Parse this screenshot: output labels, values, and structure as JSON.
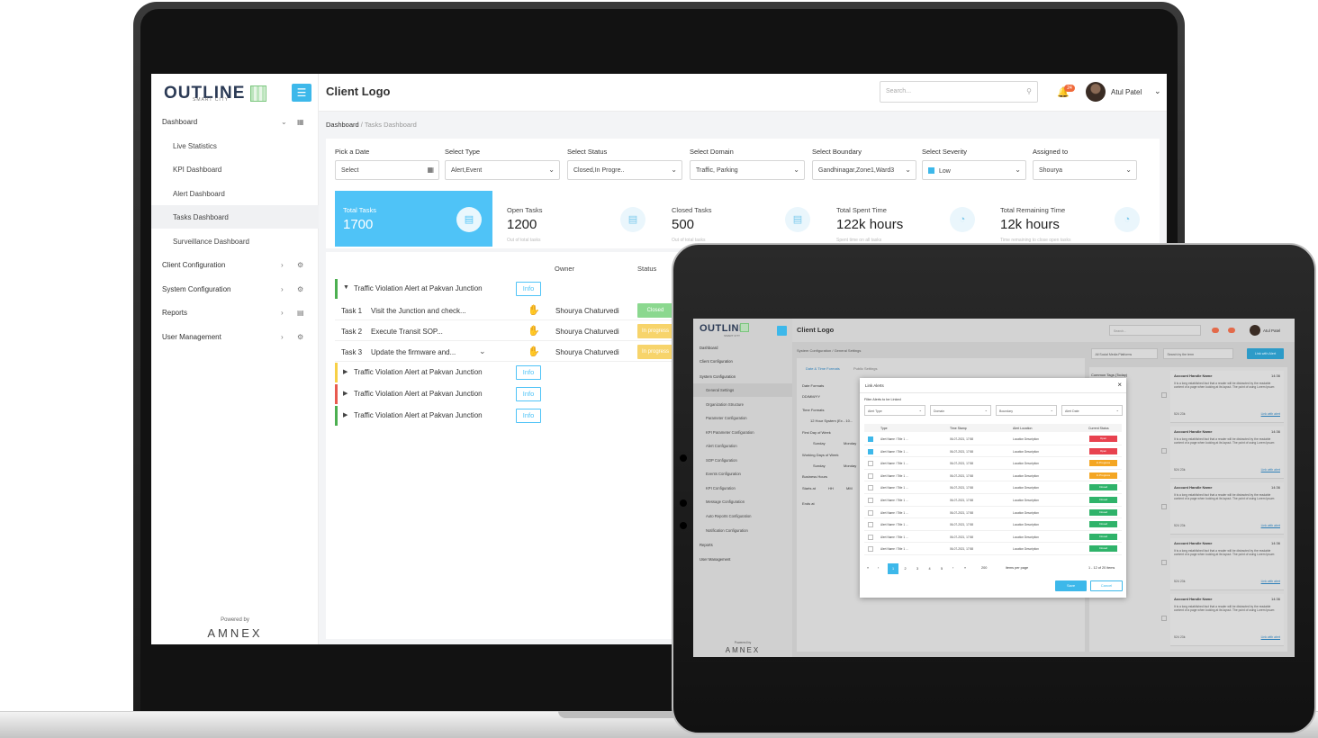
{
  "laptop": {
    "brand": {
      "name": "OUTLINE",
      "tagline": "SMART CITY"
    },
    "client_logo": "Client Logo",
    "search_placeholder": "Search...",
    "notification_count": "24",
    "user_name": "Atul Patel",
    "sidebar": {
      "items": [
        {
          "label": "Dashboard",
          "level": 0
        },
        {
          "label": "Live Statistics",
          "level": 1
        },
        {
          "label": "KPI Dashboard",
          "level": 1
        },
        {
          "label": "Alert Dashboard",
          "level": 1
        },
        {
          "label": "Tasks Dashboard",
          "level": 1,
          "active": true
        },
        {
          "label": "Surveillance Dashboard",
          "level": 1
        },
        {
          "label": "Client Configuration",
          "level": 0
        },
        {
          "label": "System Configuration",
          "level": 0
        },
        {
          "label": "Reports",
          "level": 0
        },
        {
          "label": "User Management",
          "level": 0
        }
      ],
      "powered_by": "Powered by",
      "footer_brand": "AMNEX"
    },
    "breadcrumb": {
      "root": "Dashboard",
      "current": "Tasks Dashboard"
    },
    "filters": [
      {
        "label": "Pick a Date",
        "value": "Select",
        "kind": "date"
      },
      {
        "label": "Select Type",
        "value": "Alert,Event",
        "kind": "select"
      },
      {
        "label": "Select Status",
        "value": "Closed,In Progre..",
        "kind": "select"
      },
      {
        "label": "Select Domain",
        "value": "Traffic, Parking",
        "kind": "select"
      },
      {
        "label": "Select Boundary",
        "value": "Gandhinagar,Zone1,Ward3",
        "kind": "select"
      },
      {
        "label": "Select Severity",
        "value": "Low",
        "kind": "check-select"
      },
      {
        "label": "Assigned to",
        "value": "Shourya",
        "kind": "select"
      }
    ],
    "stats": [
      {
        "label": "Total Tasks",
        "value": "1700",
        "sub": ""
      },
      {
        "label": "Open Tasks",
        "value": "1200",
        "sub": "Out of total tasks"
      },
      {
        "label": "Closed Tasks",
        "value": "500",
        "sub": "Out of total tasks"
      },
      {
        "label": "Total Spent Time",
        "value": "122k hours",
        "sub": "Spent time on all tasks"
      },
      {
        "label": "Total Remaining Time",
        "value": "12k hours",
        "sub": "Time remaining to close open tasks"
      }
    ],
    "table": {
      "headers": {
        "owner": "Owner",
        "status": "Status"
      },
      "info_label": "Info",
      "alerts": [
        {
          "title": "Traffic Violation Alert at Pakvan Junction",
          "expanded": true,
          "accent": "#4caf50",
          "tasks": [
            {
              "id": "Task 1",
              "name": "Visit the Junction and check...",
              "owner": "Shourya Chaturvedi",
              "status": "Closed",
              "color": "#8bd88f"
            },
            {
              "id": "Task 2",
              "name": "Execute Transit SOP...",
              "owner": "Shourya Chaturvedi",
              "status": "In progress",
              "color": "#f7d46b"
            },
            {
              "id": "Task 3",
              "name": "Update the firmware and...",
              "owner": "Shourya Chaturvedi",
              "status": "In progress",
              "color": "#f7d46b"
            }
          ]
        },
        {
          "title": "Traffic Violation Alert at Pakvan Junction",
          "expanded": false,
          "accent": "#f7d046"
        },
        {
          "title": "Traffic Violation Alert at Pakvan Junction",
          "expanded": false,
          "accent": "#e85a4f"
        },
        {
          "title": "Traffic Violation Alert at Pakvan Junction",
          "expanded": false,
          "accent": "#4caf50"
        }
      ]
    }
  },
  "tablet": {
    "client_logo": "Client Logo",
    "brand": "OUTLINE",
    "brand_sub": "SMART CITY",
    "user_name": "Atul Patel",
    "search_placeholder": "Search...",
    "breadcrumb": "System Configuration / General Settings",
    "sidebar": [
      {
        "label": "Dashboard",
        "level": 0
      },
      {
        "label": "Client Configuration",
        "level": 0
      },
      {
        "label": "System Configuration",
        "level": 0
      },
      {
        "label": "General Settings",
        "level": 1,
        "active": true
      },
      {
        "label": "Organization Structure",
        "level": 1
      },
      {
        "label": "Parameter Configuration",
        "level": 1
      },
      {
        "label": "KPI Parameter Configuration",
        "level": 1
      },
      {
        "label": "Alert Configuration",
        "level": 1
      },
      {
        "label": "SOP Configuration",
        "level": 1
      },
      {
        "label": "Events Configuration",
        "level": 1
      },
      {
        "label": "KPI Configuration",
        "level": 1
      },
      {
        "label": "Message Configuration",
        "level": 1
      },
      {
        "label": "Auto Reports Configuration",
        "level": 1
      },
      {
        "label": "Notification Configuration",
        "level": 1
      },
      {
        "label": "Reports",
        "level": 0
      },
      {
        "label": "User Management",
        "level": 0
      }
    ],
    "powered_by": "Powered by",
    "footer_brand": "AMNEX",
    "tabs": [
      "Date & Time Formats",
      "Public Settings"
    ],
    "fields": [
      "Date Formats",
      "DD/MM/YY",
      "Time Formats",
      "12 Hour System (Ex - 10...",
      "First Day of Week",
      "Sunday",
      "Monday",
      "Working Days of Week",
      "Sunday",
      "Monday",
      "Business Hours",
      "Starts at",
      "Ends at",
      "HH",
      "MM"
    ],
    "right_filters": {
      "platform": "All Social Media Platforms",
      "search": "Search by the term",
      "button": "Link with Alert"
    },
    "common_tags": "Common Tags (Today)",
    "feed": [
      {
        "handle": "Account Handle Name",
        "time": "14:36",
        "body": "It is a long established fact that a reader will be distracted by the readable content of a page when looking at its layout. The point of using Lorem Ipsum",
        "likes": "524",
        "shares": "23k",
        "link": "Link with alert"
      },
      {
        "handle": "Account Handle Name",
        "time": "14:36",
        "body": "It is a long established fact that a reader will be distracted by the readable content of a page when looking at its layout. The point of using Lorem Ipsum",
        "likes": "524",
        "shares": "23k",
        "link": "Link with alert"
      },
      {
        "handle": "Account Handle Name",
        "time": "14:36",
        "body": "It is a long established fact that a reader will be distracted by the readable content of a page when looking at its layout. The point of using Lorem Ipsum",
        "likes": "524",
        "shares": "23k",
        "link": "Link with alert"
      },
      {
        "handle": "Account Handle Name",
        "time": "14:36",
        "body": "It is a long established fact that a reader will be distracted by the readable content of a page when looking at its layout. The point of using Lorem Ipsum",
        "likes": "524",
        "shares": "23k",
        "link": "Link with alert"
      },
      {
        "handle": "Account Handle Name",
        "time": "14:36",
        "body": "It is a long established fact that a reader will be distracted by the readable content of a page when looking at its layout. The point of using Lorem Ipsum",
        "likes": "524",
        "shares": "23k",
        "link": "Link with alert"
      }
    ],
    "modal": {
      "title": "Link Alerts",
      "subtitle": "Filter Alerts to be Linked",
      "filters": [
        "Alert Type",
        "Domain",
        "Boundary",
        "Alert Date"
      ],
      "columns": [
        "Type",
        "Time Stamp",
        "Alert Location",
        "Current Status"
      ],
      "rows": [
        {
          "checked": true,
          "type": "Alert Name / Title 1 ...",
          "time": "06-07-2021, 17:58",
          "location": "Location Description",
          "status": "Open",
          "color": "#e8424f"
        },
        {
          "checked": true,
          "type": "Alert Name / Title 1 ...",
          "time": "06-07-2021, 17:58",
          "location": "Location Description",
          "status": "Open",
          "color": "#e8424f"
        },
        {
          "checked": false,
          "type": "Alert Name / Title 1 ...",
          "time": "06-07-2021, 17:58",
          "location": "Location Description",
          "status": "In Progress",
          "color": "#f4a623"
        },
        {
          "checked": false,
          "type": "Alert Name / Title 1 ...",
          "time": "06-07-2021, 17:58",
          "location": "Location Description",
          "status": "In Progress",
          "color": "#f4a623"
        },
        {
          "checked": false,
          "type": "Alert Name / Title 1 ...",
          "time": "06-07-2021, 17:58",
          "location": "Location Description",
          "status": "Closed",
          "color": "#2fb36a"
        },
        {
          "checked": false,
          "type": "Alert Name / Title 1 ...",
          "time": "06-07-2021, 17:58",
          "location": "Location Description",
          "status": "Closed",
          "color": "#2fb36a"
        },
        {
          "checked": false,
          "type": "Alert Name / Title 1 ...",
          "time": "06-07-2021, 17:58",
          "location": "Location Description",
          "status": "Closed",
          "color": "#2fb36a"
        },
        {
          "checked": false,
          "type": "Alert Name / Title 1 ...",
          "time": "06-07-2021, 17:58",
          "location": "Location Description",
          "status": "Closed",
          "color": "#2fb36a"
        },
        {
          "checked": false,
          "type": "Alert Name / Title 1 ...",
          "time": "06-07-2021, 17:58",
          "location": "Location Description",
          "status": "Closed",
          "color": "#2fb36a"
        },
        {
          "checked": false,
          "type": "Alert Name / Title 1 ...",
          "time": "06-07-2021, 17:58",
          "location": "Location Description",
          "status": "Closed",
          "color": "#2fb36a"
        }
      ],
      "pager": {
        "pages": [
          "1",
          "2",
          "3",
          "4",
          "5"
        ],
        "current": "1",
        "per_page": "200",
        "per_page_label": "items per page",
        "range": "1 - 12 of 20 items"
      },
      "save": "Save",
      "cancel": "Cancel"
    }
  }
}
